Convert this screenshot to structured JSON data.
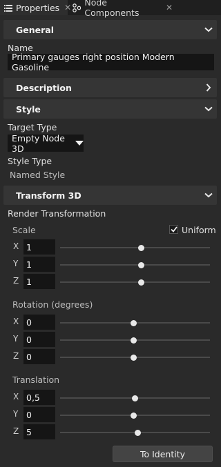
{
  "tabs": [
    {
      "label": "Properties",
      "icon": "list-icon"
    },
    {
      "label": "Node Components",
      "icon": "components-icon"
    }
  ],
  "sections": {
    "general": "General",
    "description": "Description",
    "style": "Style",
    "transform": "Transform 3D"
  },
  "general": {
    "name_label": "Name",
    "name_value": "Primary gauges right position Modern Gasoline"
  },
  "style": {
    "target_type_label": "Target Type",
    "target_type_value": "Empty Node 3D",
    "style_type_label": "Style Type",
    "style_type_value": "Named Style"
  },
  "transform": {
    "render_label": "Render Transformation",
    "scale_label": "Scale",
    "uniform_label": "Uniform",
    "uniform_checked": true,
    "rotation_label": "Rotation (degrees)",
    "translation_label": "Translation",
    "axes": [
      "X",
      "Y",
      "Z"
    ],
    "scale": [
      {
        "value": "1",
        "fraction": 0.54
      },
      {
        "value": "1",
        "fraction": 0.54
      },
      {
        "value": "1",
        "fraction": 0.54
      }
    ],
    "rotation": [
      {
        "value": "0",
        "fraction": 0.49
      },
      {
        "value": "0",
        "fraction": 0.49
      },
      {
        "value": "0",
        "fraction": 0.49
      }
    ],
    "translation": [
      {
        "value": "0,5",
        "fraction": 0.5
      },
      {
        "value": "0",
        "fraction": 0.49
      },
      {
        "value": "5",
        "fraction": 0.52
      }
    ],
    "identity_button": "To Identity"
  },
  "colors": {
    "background": "#2a2a2a",
    "header": "#353535",
    "field": "#151515"
  }
}
